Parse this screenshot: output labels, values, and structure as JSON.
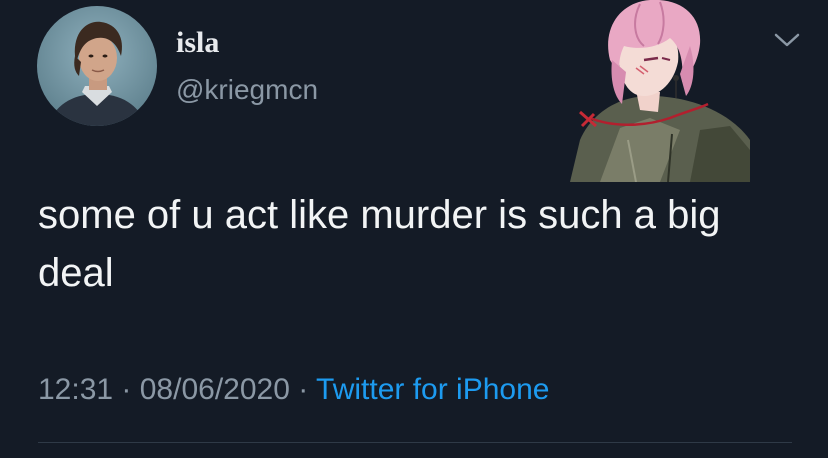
{
  "tweet": {
    "display_name": "isla",
    "handle": "@kriegmcn",
    "text": "some of u act like murder is such a big deal",
    "time": "12:31",
    "separator": " · ",
    "date": "08/06/2020",
    "source": "Twitter for iPhone"
  },
  "icons": {
    "avatar": "profile-photo",
    "sticker": "anime-character-sticker",
    "menu": "chevron-down-icon"
  },
  "colors": {
    "background": "#141b26",
    "text": "#f2f4f5",
    "secondary": "#8b98a5",
    "link": "#1d9bf0"
  }
}
